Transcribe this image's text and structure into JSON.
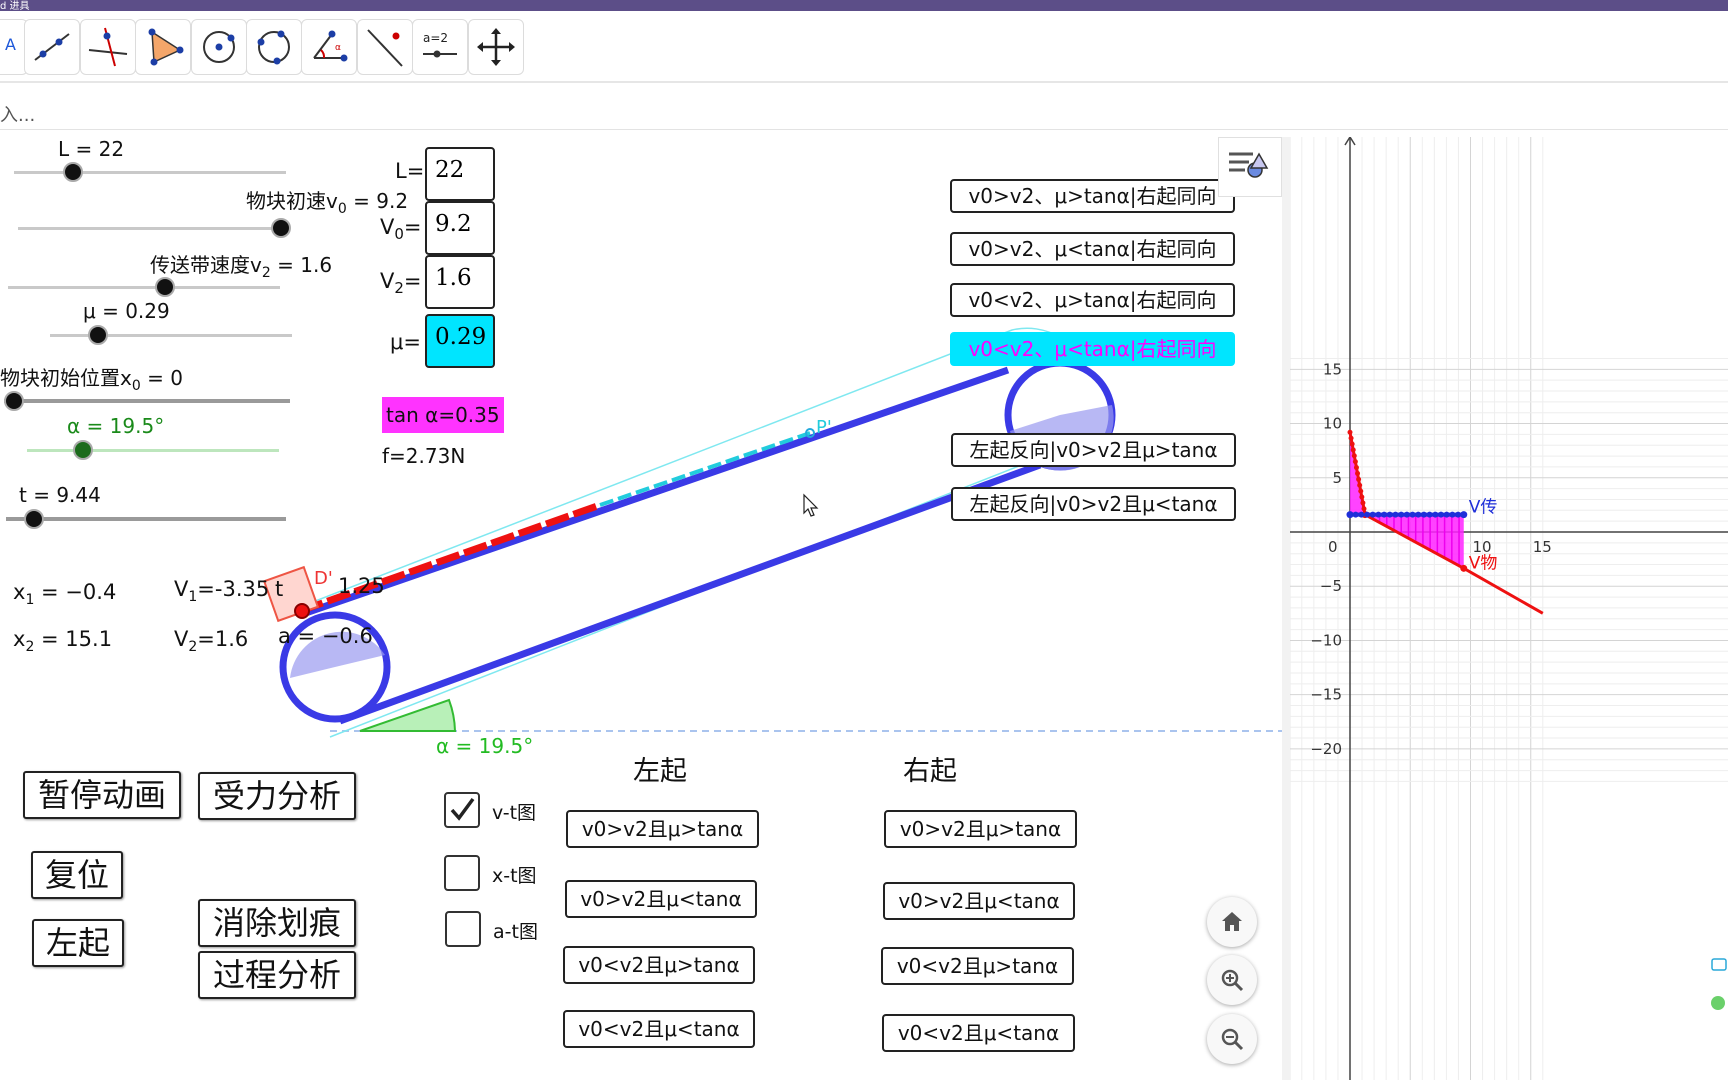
{
  "window": {
    "title_fragment": "d 进具"
  },
  "toolbar": {
    "tools": [
      {
        "icon": "move-icon"
      },
      {
        "icon": "line-icon"
      },
      {
        "icon": "perpendicular-line-icon"
      },
      {
        "icon": "polygon-icon"
      },
      {
        "icon": "circle-center-point-icon"
      },
      {
        "icon": "circle-three-points-icon"
      },
      {
        "icon": "angle-icon"
      },
      {
        "icon": "reflect-about-line-icon"
      },
      {
        "icon": "slider-icon"
      },
      {
        "icon": "move-graphics-view-icon"
      }
    ],
    "slider_tool_label": "a=2"
  },
  "input_bar": {
    "placeholder": "入..."
  },
  "sliders": {
    "L": {
      "label": "L = 22",
      "fraction": 0.2
    },
    "v0": {
      "label": "物块初速v",
      "sub": "0",
      "suffix": " = 9.2",
      "fraction": 0.95
    },
    "v2": {
      "label": "传送带速度v",
      "sub": "2",
      "suffix": " = 1.6",
      "fraction": 0.58
    },
    "mu": {
      "label": "μ  = 0.29",
      "fraction": 0.2
    },
    "x0": {
      "label": "物块初始位置x",
      "sub": "0",
      "suffix": " = 0",
      "fraction": 0.0
    },
    "alpha": {
      "label": "α  = 19.5°",
      "fraction": 0.22
    },
    "t": {
      "label": "t  = 9.44",
      "fraction": 0.1
    }
  },
  "inputs": [
    {
      "label": "L=",
      "value": "22"
    },
    {
      "label": "V",
      "sub": "0",
      "after": "=",
      "value": "9.2"
    },
    {
      "label": "V",
      "sub": "2",
      "after": "=",
      "value": "1.6"
    },
    {
      "label": "μ=",
      "value": "0.29"
    }
  ],
  "info": {
    "tan": "tan α=0.35",
    "force": "f=2.73N",
    "x1_label": "x",
    "x1_sub": "1",
    "x1_value": " =  −0.4",
    "x2_label": "x",
    "x2_sub": "2",
    "x2_value": " =  15.1",
    "v1_label": "V",
    "v1_sub": "1",
    "v1_value": "=-3.35",
    "v2_label": "V",
    "v2_sub": "2",
    "v2_value": "=1.6",
    "t1": "t",
    "t1_value": "1.25",
    "a_value": "a  =  −0.6",
    "angle_label": "α = 19.5°",
    "point_p": "P'",
    "point_d": "D'"
  },
  "case_buttons": [
    "v0>v2、μ>tanα|右起同向",
    "v0>v2、μ<tanα|右起同向",
    "v0<v2、μ>tanα|右起同向",
    "v0<v2、μ<tanα|右起同向",
    "左起反向|v0>v2且μ>tanα",
    "左起反向|v0>v2且μ<tanα"
  ],
  "control_buttons": {
    "pause": "暂停动画",
    "force": "受力分析",
    "reset": "复位",
    "left_start": "左起",
    "clear": "消除划痕",
    "process": "过程分析"
  },
  "graph_checks": [
    {
      "label": "v-t图",
      "checked": true
    },
    {
      "label": "x-t图",
      "checked": false
    },
    {
      "label": "a-t图",
      "checked": false
    }
  ],
  "columns": {
    "left_title": "左起",
    "right_title": "右起",
    "left": [
      "v0>v2且μ>tanα",
      "v0>v2且μ<tanα",
      "v0<v2且μ>tanα",
      "v0<v2且μ<tanα"
    ],
    "right": [
      "v0>v2且μ>tanα",
      "v0>v2且μ<tanα",
      "v0<v2且μ>tanα",
      "v0<v2且μ<tanα"
    ]
  },
  "view_controls": [
    "home-icon",
    "zoom-in-icon",
    "zoom-out-icon"
  ],
  "colors": {
    "accent": "#5c4e88",
    "belt": "#3a3ae6",
    "highlight_bg": "#00e5ff",
    "highlight_fg": "#ff00ff",
    "tan_bg": "#ff33ff",
    "trace": "#ee1111"
  },
  "chart_data": {
    "type": "line",
    "x_ticks": [
      "0",
      "10",
      "15"
    ],
    "y_ticks": [
      "15",
      "10",
      "5",
      "−5",
      "−10",
      "−15",
      "−20"
    ],
    "xlim": [
      -5,
      16
    ],
    "ylim": [
      -23,
      16
    ],
    "series": [
      {
        "name": "V传",
        "color": "#1f2fd9",
        "points": [
          [
            0,
            1.6
          ],
          [
            9.44,
            1.6
          ]
        ]
      },
      {
        "name": "V物",
        "color": "#ee1111",
        "points": [
          [
            0,
            9.2
          ],
          [
            1.25,
            1.6
          ],
          [
            9.44,
            -3.35
          ],
          [
            16,
            -7.5
          ]
        ]
      }
    ],
    "shaded_fill": "#ff22ff",
    "grid": true
  }
}
